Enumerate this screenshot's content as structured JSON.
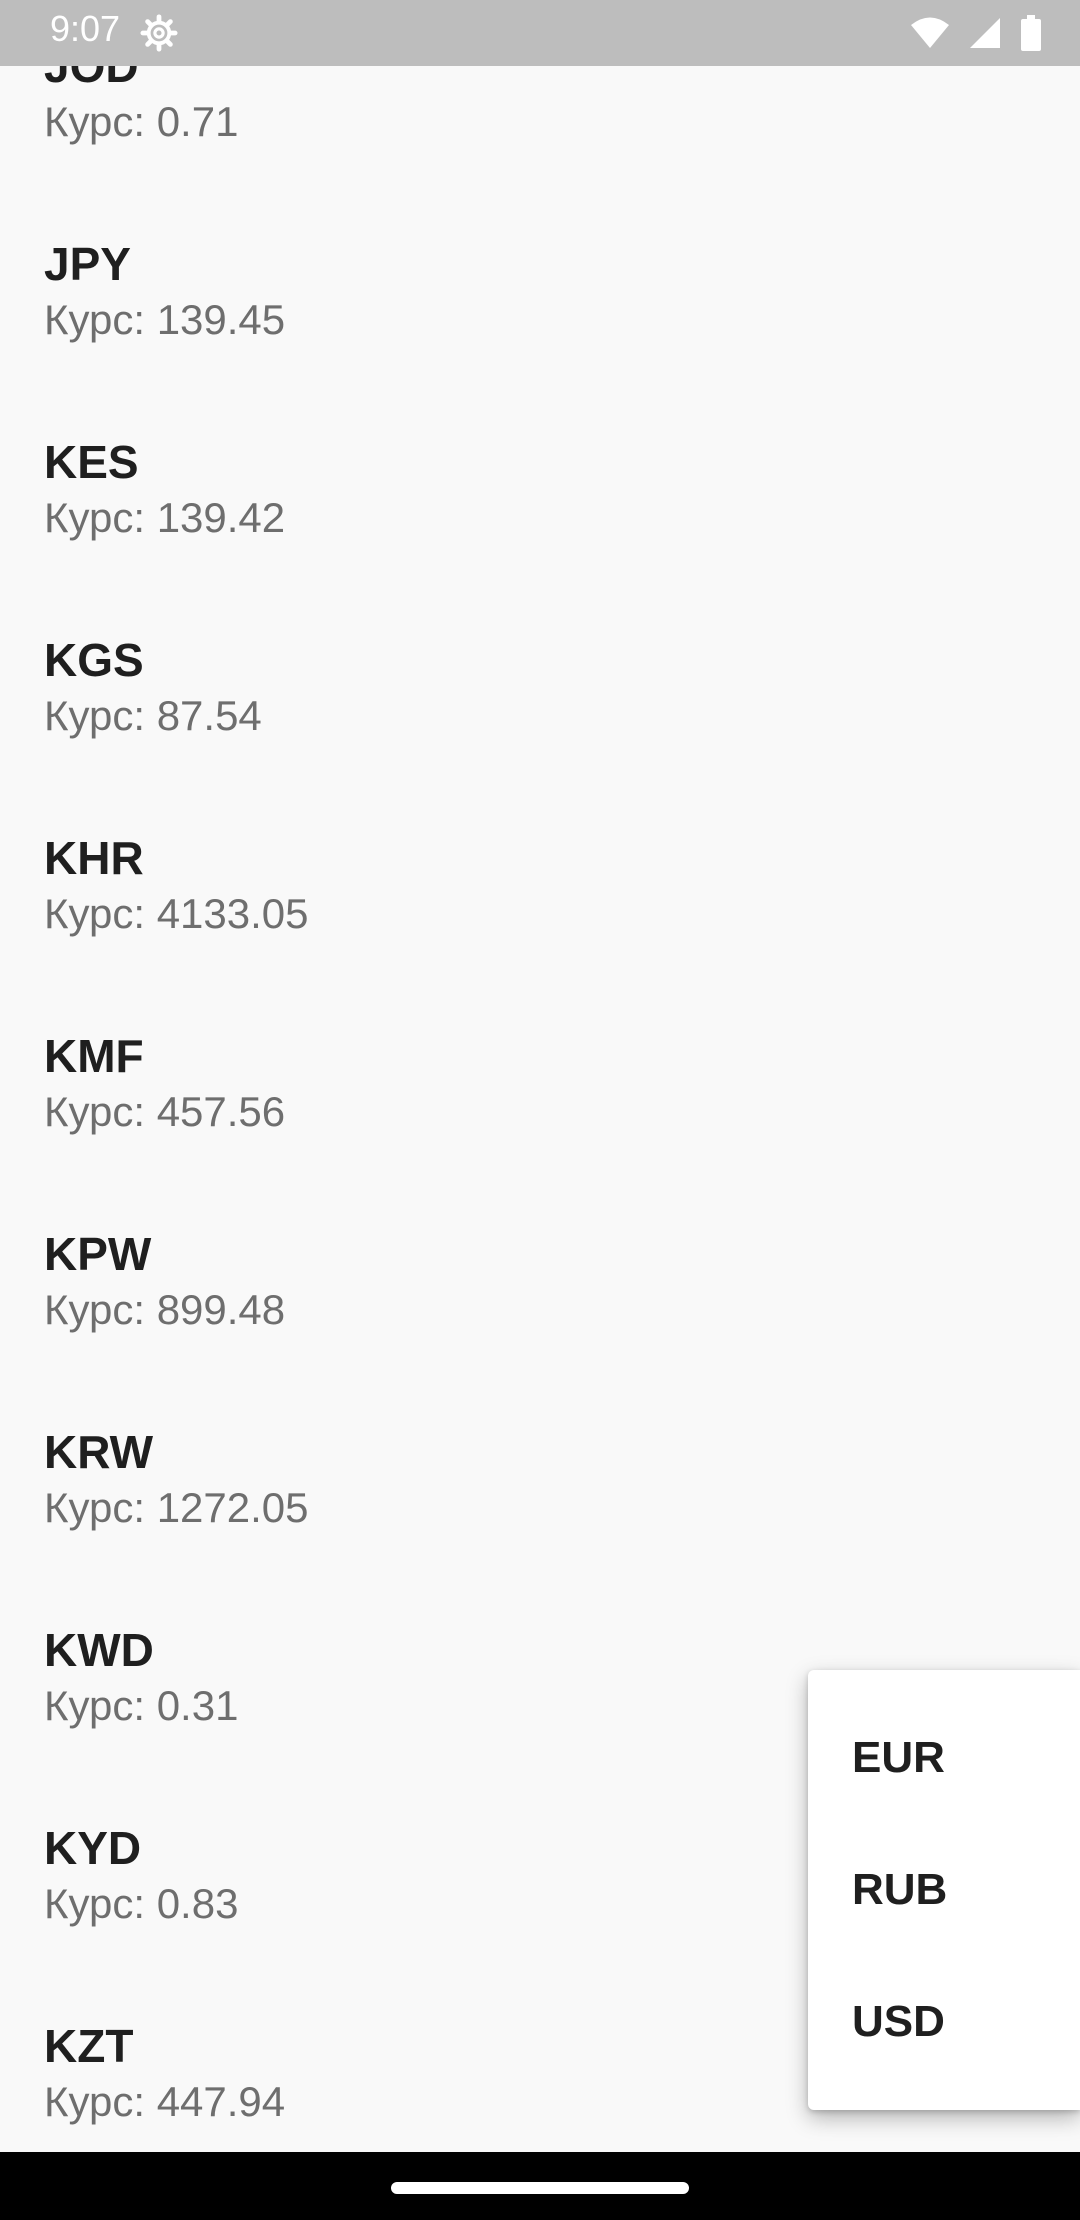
{
  "status_bar": {
    "time": "9:07",
    "icons": [
      "settings-icon",
      "wifi-icon",
      "cell-signal-icon",
      "battery-icon"
    ]
  },
  "currencies": [
    {
      "code": "JOD",
      "rate": "Курс: 0.71"
    },
    {
      "code": "JPY",
      "rate": "Курс: 139.45"
    },
    {
      "code": "KES",
      "rate": "Курс: 139.42"
    },
    {
      "code": "KGS",
      "rate": "Курс: 87.54"
    },
    {
      "code": "KHR",
      "rate": "Курс: 4133.05"
    },
    {
      "code": "KMF",
      "rate": "Курс: 457.56"
    },
    {
      "code": "KPW",
      "rate": "Курс: 899.48"
    },
    {
      "code": "KRW",
      "rate": "Курс: 1272.05"
    },
    {
      "code": "KWD",
      "rate": "Курс: 0.31"
    },
    {
      "code": "KYD",
      "rate": "Курс: 0.83"
    },
    {
      "code": "KZT",
      "rate": "Курс: 447.94"
    }
  ],
  "popup_menu": {
    "items": [
      "EUR",
      "RUB",
      "USD"
    ]
  },
  "colors": {
    "status_bar_bg": "#bdbdbd",
    "background": "#f9f9f9",
    "code_text": "#1f1f1f",
    "rate_text": "#6e6e6e",
    "nav_bar_bg": "#000000"
  }
}
